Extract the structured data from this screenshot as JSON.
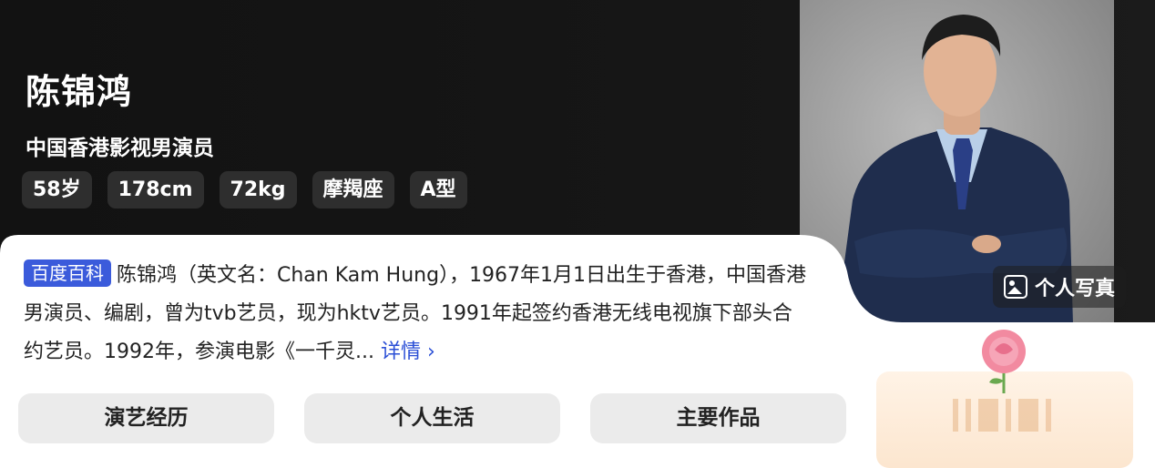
{
  "profile": {
    "name": "陈锦鸿",
    "subtitle": "中国香港影视男演员",
    "tags": [
      "58岁",
      "178cm",
      "72kg",
      "摩羯座",
      "A型"
    ]
  },
  "photo_button": {
    "label": "个人写真",
    "icon": "image-icon"
  },
  "summary": {
    "source_badge": "百度百科",
    "text": "陈锦鸿（英文名：Chan Kam Hung），1967年1月1日出生于香港，中国香港男演员、编剧，曾为tvb艺员，现为hktv艺员。1991年起签约香港无线电视旗下部头合约艺员。1992年，参演电影《一千灵...",
    "more_label": "详情 ›"
  },
  "tabs": [
    {
      "label": "演艺经历"
    },
    {
      "label": "个人生活"
    },
    {
      "label": "主要作品"
    }
  ],
  "colors": {
    "background": "#141414",
    "card": "#ffffff",
    "accent": "#3b5bdb",
    "link": "#2b4fd6",
    "tag_bg": "#2e2e2e",
    "tab_bg": "#ebebeb"
  },
  "decoration": {
    "icon": "rose-icon"
  }
}
